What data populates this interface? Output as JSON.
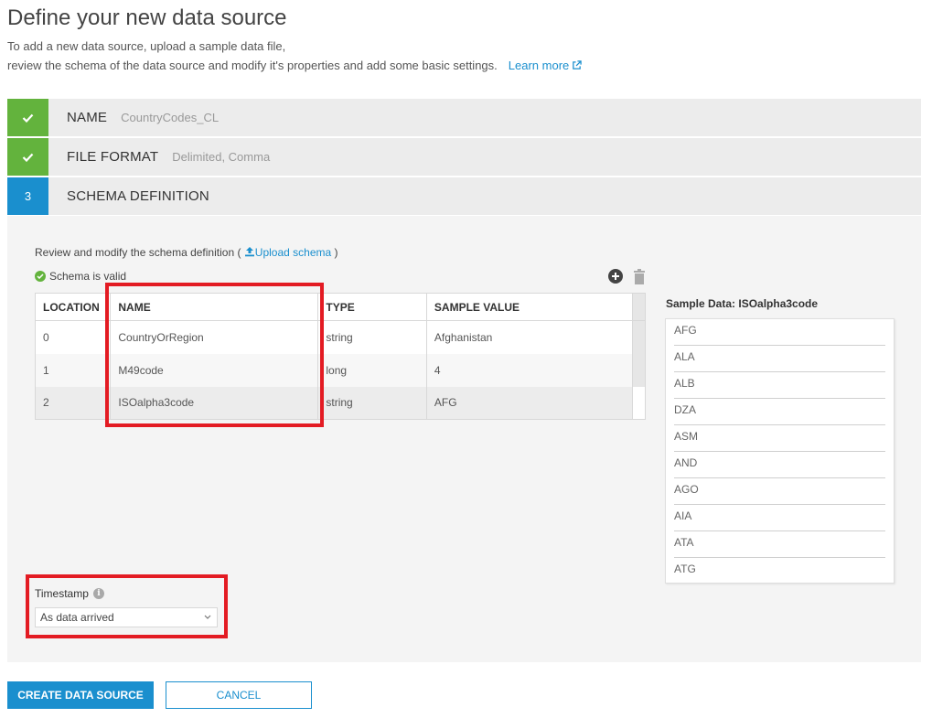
{
  "header": {
    "title": "Define your new data source",
    "desc_line1": "To add a new data source, upload a sample data file,",
    "desc_line2": "review the schema of the data source and modify it's properties and add some basic settings.",
    "learn_more": "Learn more"
  },
  "steps": [
    {
      "badge": "",
      "name": "NAME",
      "value": "CountryCodes_CL",
      "state": "done"
    },
    {
      "badge": "",
      "name": "FILE FORMAT",
      "value": "Delimited, Comma",
      "state": "done"
    },
    {
      "badge": "3",
      "name": "SCHEMA DEFINITION",
      "value": "",
      "state": "active"
    }
  ],
  "schema": {
    "review_text": "Review and modify the schema definition (",
    "upload_label": "Upload schema",
    "review_close": ")",
    "valid_text": "Schema is valid",
    "columns": [
      "LOCATION",
      "NAME",
      "TYPE",
      "SAMPLE VALUE"
    ],
    "rows": [
      [
        "0",
        "CountryOrRegion",
        "string",
        "Afghanistan"
      ],
      [
        "1",
        "M49code",
        "long",
        "4"
      ],
      [
        "2",
        "ISOalpha3code",
        "string",
        "AFG"
      ]
    ]
  },
  "sample_data": {
    "title": "Sample Data: ISOalpha3code",
    "items": [
      "AFG",
      "ALA",
      "ALB",
      "DZA",
      "ASM",
      "AND",
      "AGO",
      "AIA",
      "ATA",
      "ATG"
    ]
  },
  "timestamp": {
    "label": "Timestamp",
    "value": "As data arrived"
  },
  "buttons": {
    "create": "CREATE DATA SOURCE",
    "cancel": "CANCEL"
  },
  "colors": {
    "accent": "#1a8fce",
    "success": "#63b33d",
    "highlight": "#e31b23"
  }
}
